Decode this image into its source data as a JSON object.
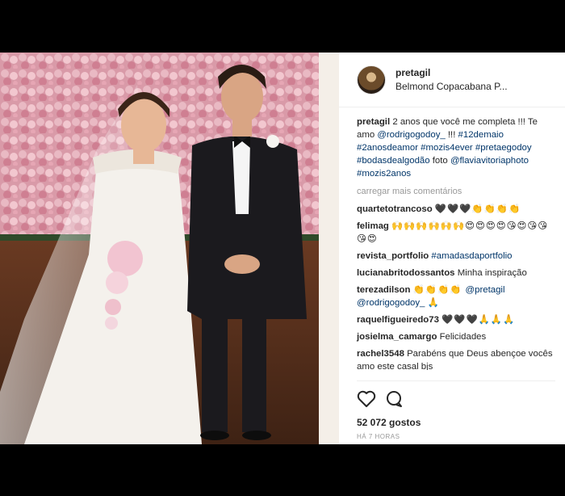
{
  "post": {
    "username": "pretagil",
    "location": "Belmond Copacabana P..."
  },
  "caption": {
    "author": "pretagil",
    "text1": " 2 anos que você me completa !!! Te amo ",
    "mention1": "@rodrigogodoy_",
    "text2": " !!! ",
    "hashtags": "#12demaio #2anosdeamor #mozis4ever #pretaegodoy #bodasdealgodão",
    "text3": " foto ",
    "mention2": "@flaviavitoriaphoto",
    "hashtag_last": "#mozis2anos"
  },
  "load_more": "carregar mais comentários",
  "comments": [
    {
      "author": "quartetotrancoso",
      "text": "🖤🖤🖤👏👏👏👏"
    },
    {
      "author": "felimag",
      "text": "🙌🙌🙌🙌🙌🙌😍😍😍😍😘😍😘😘😘😍"
    },
    {
      "author": "revista_portfolio",
      "link": "#amadasdaportfolio"
    },
    {
      "author": "lucianabritodossantos",
      "text": "Minha inspiração"
    },
    {
      "author": "terezadilson",
      "text": "👏👏👏👏 ",
      "link": "@pretagil @rodrigogodoy_",
      "text2": " 🙏"
    },
    {
      "author": "raquelfigueiredo73",
      "text": "🖤🖤🖤🙏🙏🙏"
    },
    {
      "author": "josielma_camargo",
      "text": "Felicidades"
    },
    {
      "author": "rachel3548",
      "text": "Parabéns que Deus abençoe vocês amo este casal bjs"
    }
  ],
  "likes": "52 072 gostos",
  "time": "HÁ 7 HORAS",
  "icons": {
    "like": "heart-icon",
    "comment": "comment-icon"
  },
  "colors": {
    "link": "#003569",
    "muted": "#999999",
    "text": "#262626"
  }
}
